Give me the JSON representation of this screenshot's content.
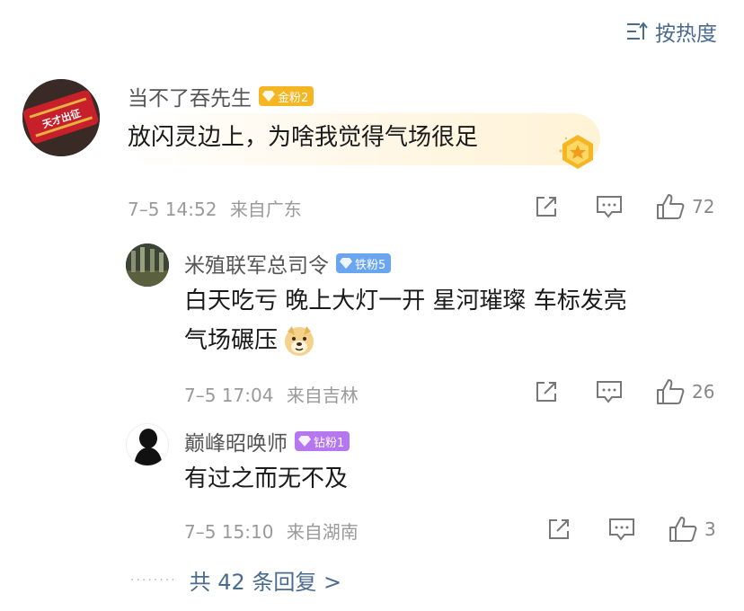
{
  "sort": {
    "label": "按热度"
  },
  "main_comment": {
    "avatar_text": "天才出征",
    "username": "当不了吞先生",
    "badge": {
      "label": "金粉2",
      "color": "#f5b623"
    },
    "text": "放闪灵边上，为啥我觉得气场很足",
    "time": "7–5 14:52",
    "location": "来自广东",
    "likes": "72"
  },
  "replies": [
    {
      "username": "米殖联军总司令",
      "badge": {
        "label": "铁粉5",
        "color": "#6aa6f0"
      },
      "text_line1": "白天吃亏 晚上大灯一开 星河璀璨 车标发亮",
      "text_line2": "气场碾压",
      "time": "7–5 17:04",
      "location": "来自吉林",
      "likes": "26"
    },
    {
      "username": "巅峰昭唤师",
      "badge": {
        "label": "钻粉1",
        "color": "#b577ef"
      },
      "text": "有过之而无不及",
      "time": "7–5 15:10",
      "location": "来自湖南",
      "likes": "3"
    }
  ],
  "more_replies": {
    "label": "共 42 条回复 >"
  },
  "icons": [
    "sort-icon",
    "share-icon",
    "comment-icon",
    "like-icon",
    "doge-emoji",
    "medal-icon",
    "gem-icon"
  ]
}
